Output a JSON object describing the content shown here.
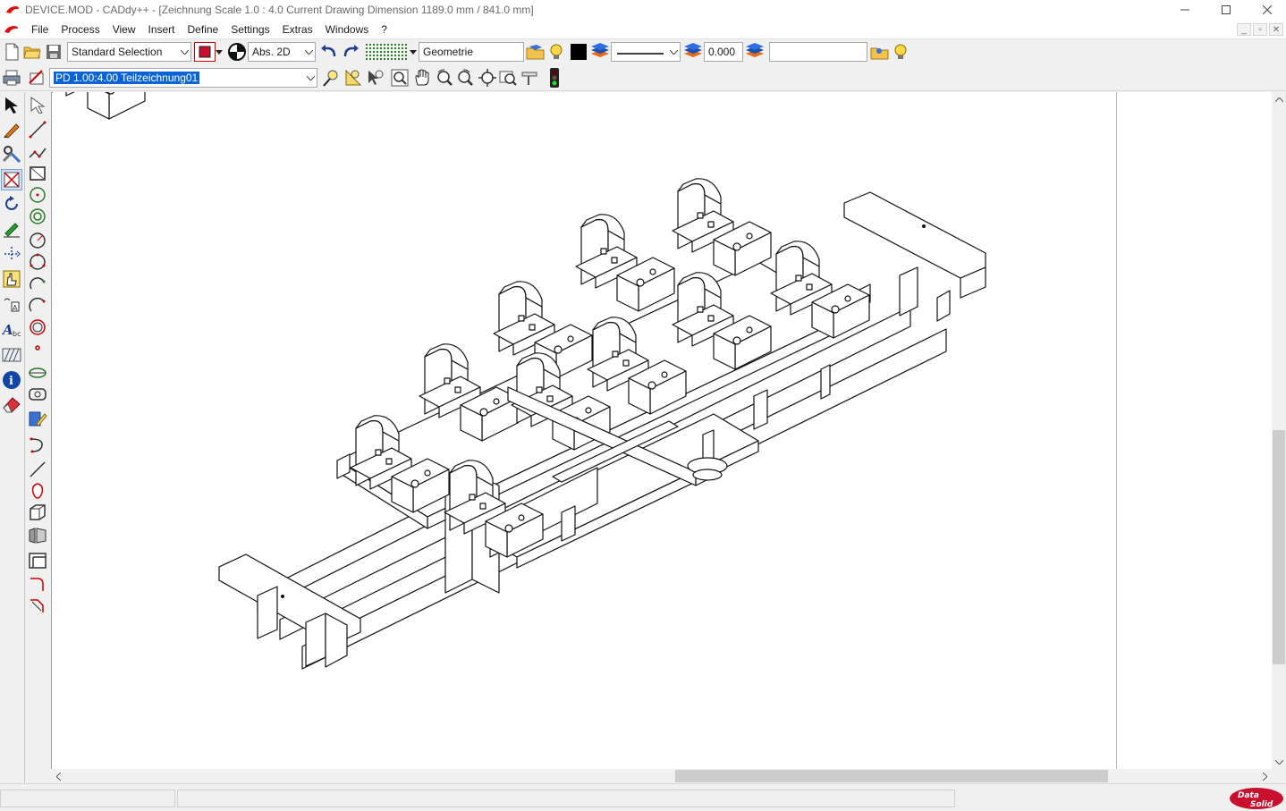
{
  "window": {
    "title": "DEVICE.MOD  -  CADdy++  - [Zeichnung   Scale 1.0 : 4.0   Current Drawing Dimension 1189.0 mm / 841.0 mm]"
  },
  "menu": [
    "File",
    "Process",
    "View",
    "Insert",
    "Define",
    "Settings",
    "Extras",
    "Windows",
    "?"
  ],
  "toolbar1": {
    "selection_mode": "Standard Selection",
    "coord_mode": "Abs. 2D",
    "layer_name": "Geometrie",
    "line_width": "0.000",
    "search_value": ""
  },
  "toolbar2": {
    "partial_drawing": "PD 1.00:4.00 Teilzeichnung01"
  },
  "colors": {
    "accent_red": "#c8102e",
    "selection_blue": "#0a64d6"
  },
  "brand": {
    "logo_text": "DataSolid"
  }
}
